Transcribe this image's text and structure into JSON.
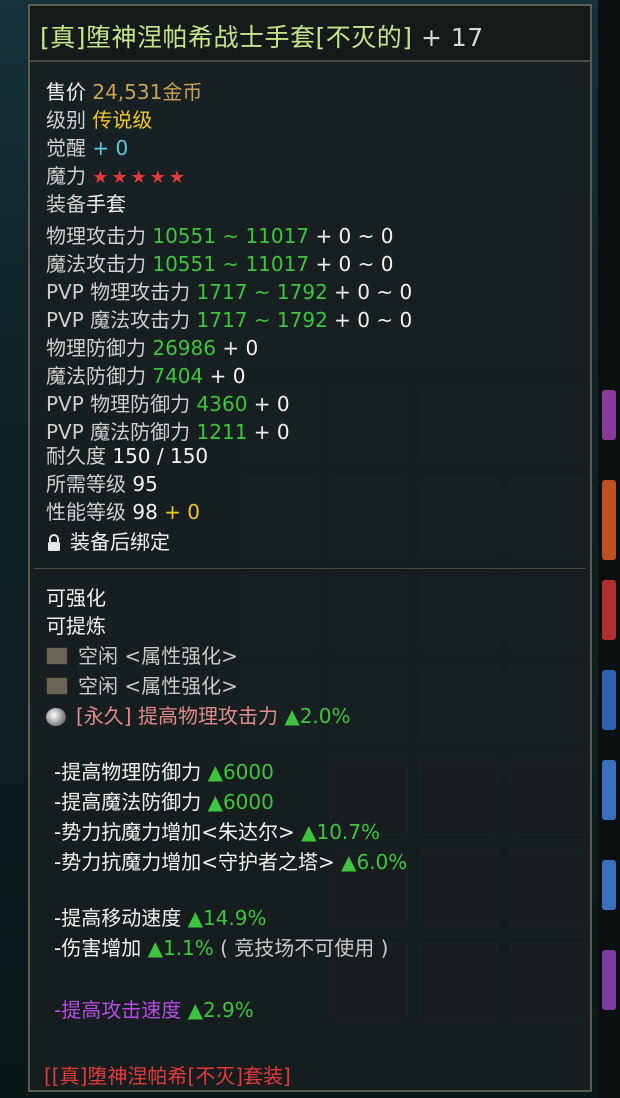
{
  "item": {
    "title": "[真]堕神涅帕希战士手套[不灭的]",
    "enhance": "+ 17"
  },
  "info": {
    "price_label": "售价",
    "price_value": "24,531金币",
    "grade_label": "级别",
    "grade_value": "传说级",
    "awaken_label": "觉醒",
    "awaken_value": "+ 0",
    "magic_label": "魔力",
    "magic_stars": 5,
    "equip_label": "装备",
    "equip_value": "手套"
  },
  "stats": [
    {
      "label": "物理攻击力",
      "value": "10551 ~ 11017",
      "bonus": "+ 0 ~ 0"
    },
    {
      "label": "魔法攻击力",
      "value": "10551 ~ 11017",
      "bonus": "+ 0 ~ 0"
    },
    {
      "label": "PVP 物理攻击力",
      "value": "1717 ~ 1792",
      "bonus": "+ 0 ~ 0"
    },
    {
      "label": "PVP 魔法攻击力",
      "value": "1717 ~ 1792",
      "bonus": "+ 0 ~ 0"
    },
    {
      "label": "物理防御力",
      "value": "26986",
      "bonus": "+ 0"
    },
    {
      "label": "魔法防御力",
      "value": "7404",
      "bonus": "+ 0"
    },
    {
      "label": "PVP 物理防御力",
      "value": "4360",
      "bonus": "+ 0"
    },
    {
      "label": "PVP 魔法防御力",
      "value": "1211",
      "bonus": "+ 0"
    }
  ],
  "durability": {
    "label": "耐久度",
    "value": "150 / 150"
  },
  "req_level": {
    "label": "所需等级",
    "value": "95"
  },
  "perf_level": {
    "label": "性能等级",
    "value": "98",
    "bonus": "+ 0"
  },
  "bind_text": "装备后绑定",
  "upgrade": {
    "enhance_text": "可强化",
    "refine_text": "可提炼",
    "sockets": [
      {
        "text": "空闲 <属性强化>"
      },
      {
        "text": "空闲 <属性强化>"
      }
    ],
    "permanent": {
      "prefix": "[永久]",
      "label": "提高物理攻击力",
      "value": "▲2.0%"
    }
  },
  "options": [
    {
      "label": "-提高物理防御力",
      "value": "▲6000",
      "group": 1
    },
    {
      "label": "-提高魔法防御力",
      "value": "▲6000",
      "group": 1
    },
    {
      "label": "-势力抗魔力增加<朱达尔>",
      "value": "▲10.7%",
      "group": 1
    },
    {
      "label": "-势力抗魔力增加<守护者之塔>",
      "value": "▲6.0%",
      "group": 1
    },
    {
      "label": "-提高移动速度",
      "value": "▲14.9%",
      "group": 2
    },
    {
      "label": "-伤害增加",
      "value": "▲1.1%",
      "note": "( 竞技场不可使用 )",
      "group": 2
    },
    {
      "label": "-提高攻击速度",
      "value": "▲2.9%",
      "group": 3
    }
  ],
  "set_name": "[[真]堕神涅帕希[不灭]套装]",
  "colors": {
    "title": "#c9e38a",
    "gold": "#c7a25a",
    "green": "#3fc43f",
    "cyan": "#5ec9e8",
    "yellow": "#f1c52b",
    "red": "#e23b3b",
    "purple": "#b54be8"
  },
  "icons": [
    "socket-icon",
    "orb-icon",
    "lock-icon",
    "star-icon"
  ]
}
